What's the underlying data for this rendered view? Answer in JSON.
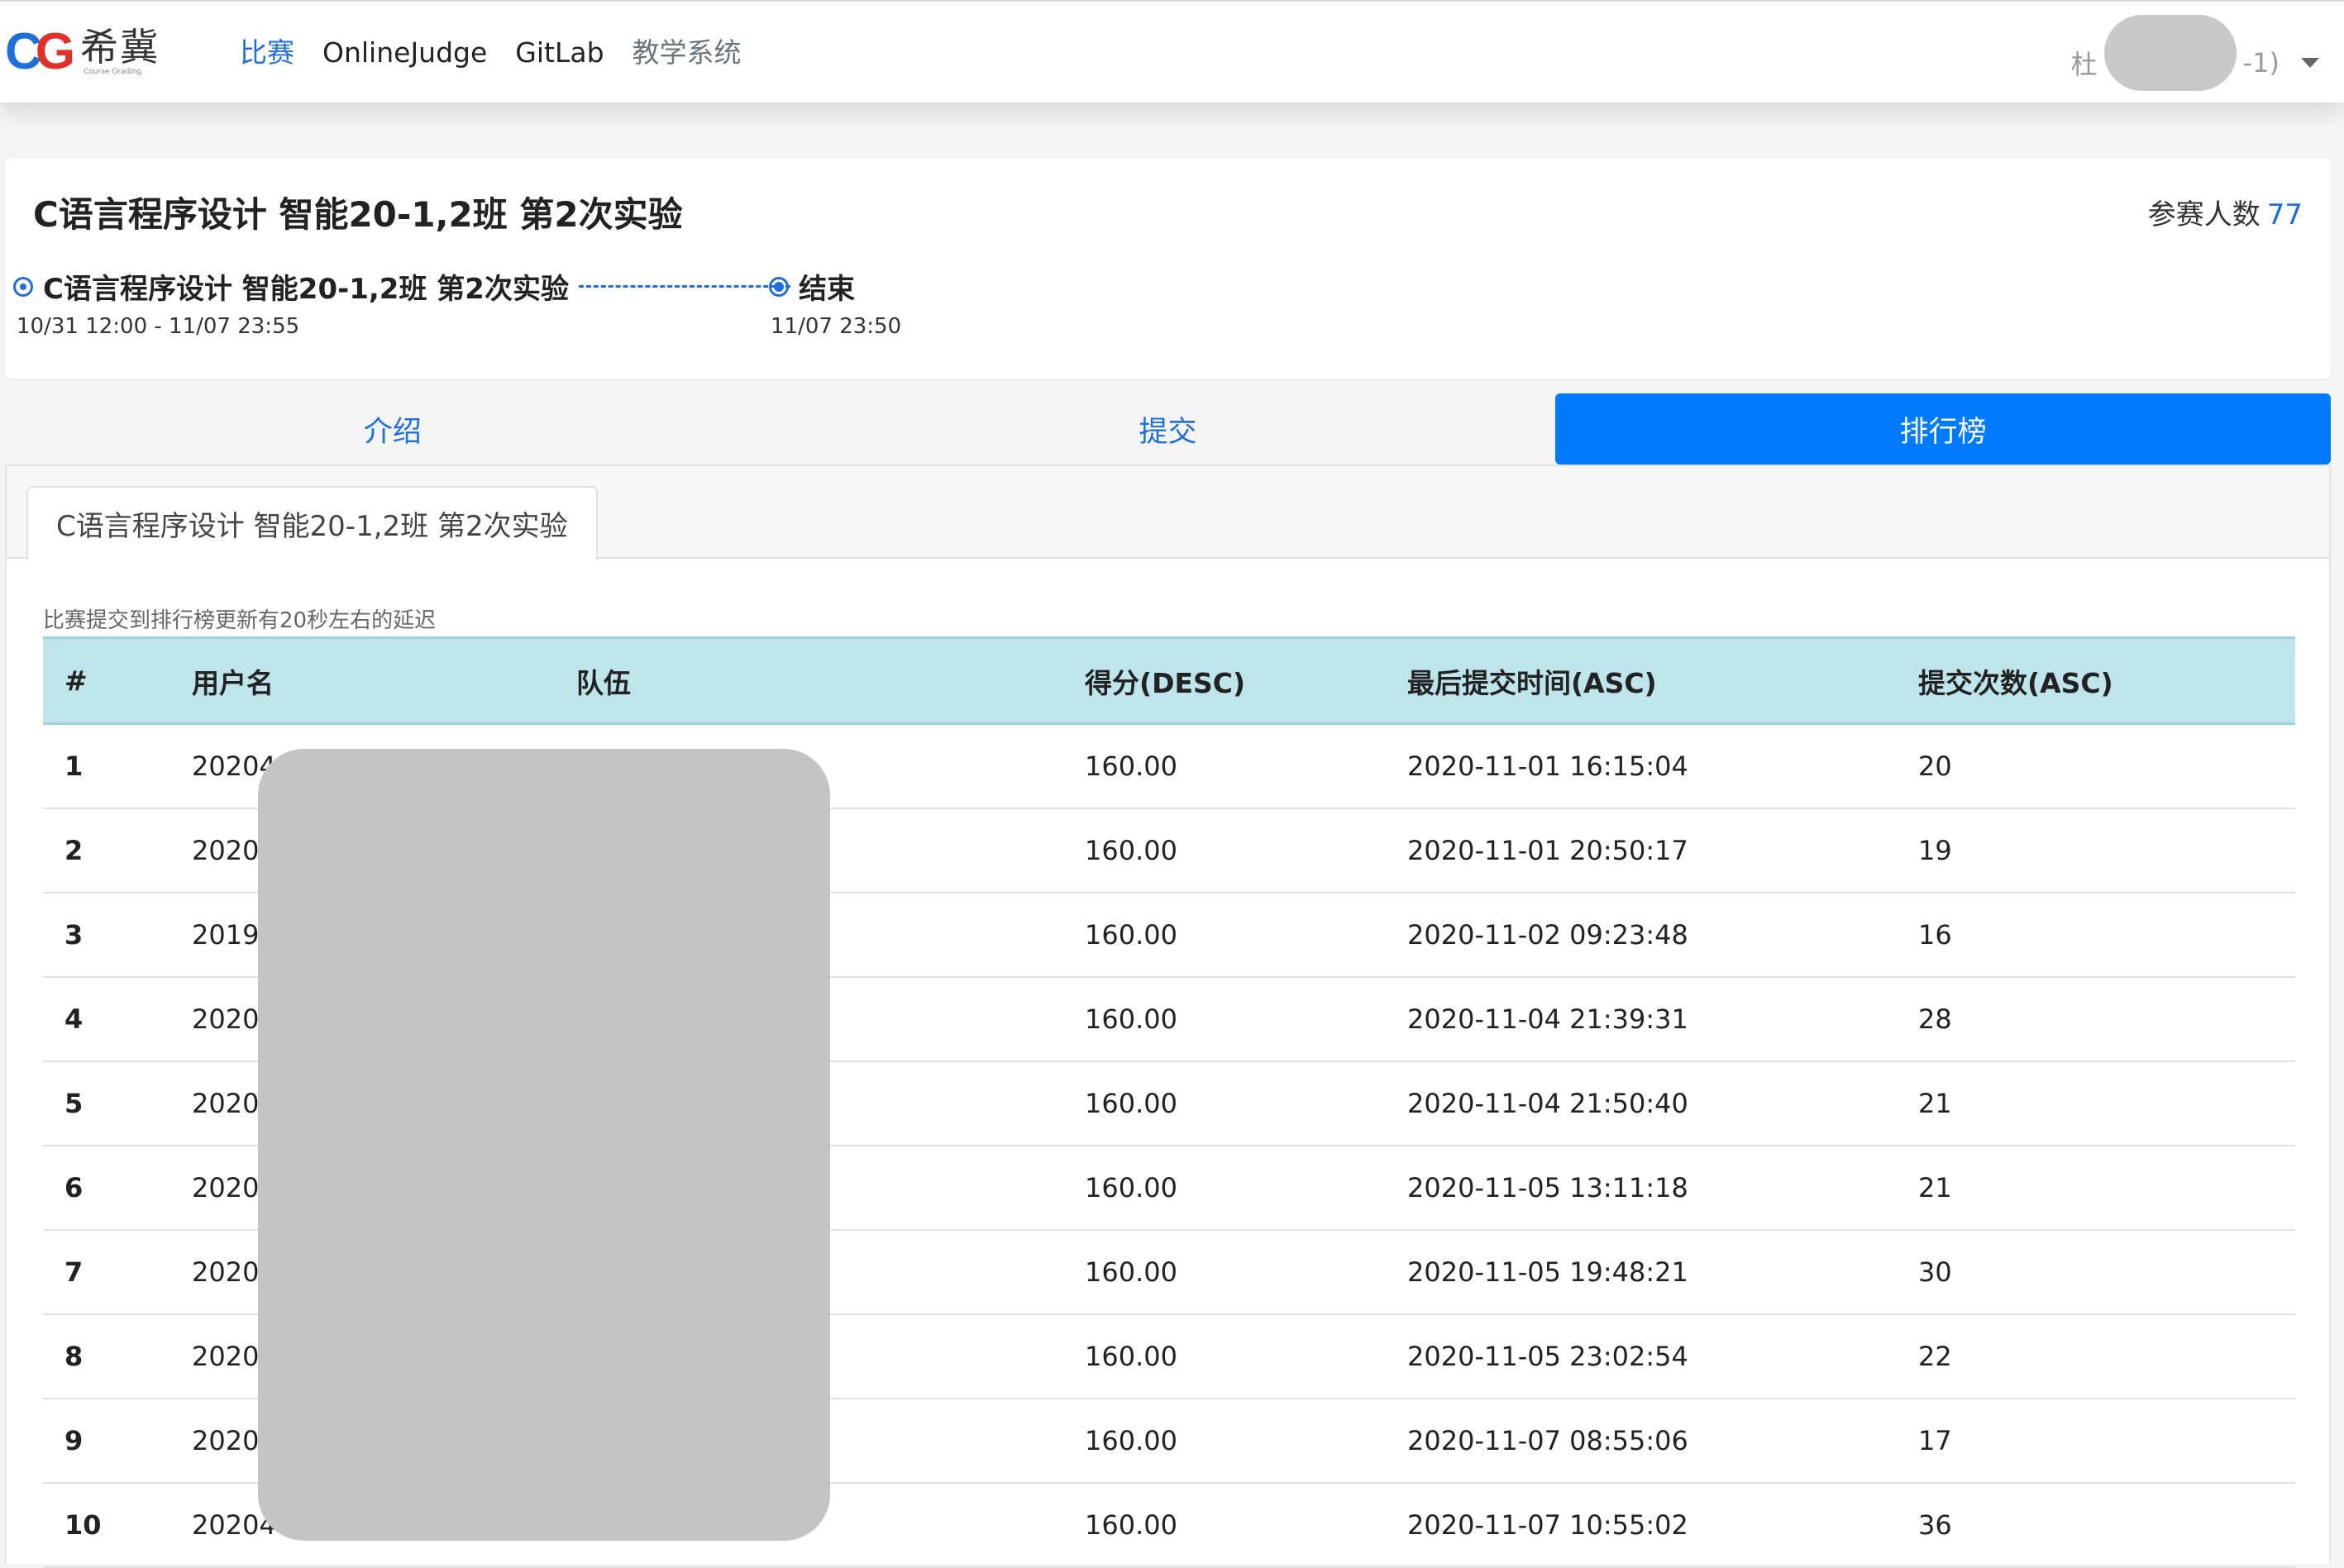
{
  "nav": {
    "logo_mark_c": "C",
    "logo_mark_g": "G",
    "logo_cn": "希冀",
    "logo_en": "Course Grading",
    "items": [
      {
        "label": "比赛"
      },
      {
        "label": "OnlineJudge"
      },
      {
        "label": "GitLab"
      },
      {
        "label": "教学系统"
      }
    ],
    "user_prefix": "杜",
    "user_suffix": "-1)"
  },
  "contest": {
    "title": "C语言程序设计 智能20-1,2班 第2次实验",
    "participants_label": "参赛人数",
    "participants_count": "77",
    "timeline": [
      {
        "label": "C语言程序设计 智能20-1,2班 第2次实验",
        "time": "10/31 12:00 - 11/07 23:55"
      },
      {
        "label": "结束",
        "time": "11/07 23:50"
      }
    ]
  },
  "tabs": [
    {
      "label": "介绍"
    },
    {
      "label": "提交"
    },
    {
      "label": "排行榜"
    }
  ],
  "subtab": {
    "label": "C语言程序设计 智能20-1,2班 第2次实验"
  },
  "notice": "比赛提交到排行榜更新有20秒左右的延迟",
  "table": {
    "headers": [
      "#",
      "用户名",
      "队伍",
      "得分(DESC)",
      "最后提交时间(ASC)",
      "提交次数(ASC)"
    ],
    "rows": [
      {
        "rank": "1",
        "user": "202044",
        "team": "",
        "score": "160.00",
        "time": "2020-11-01 16:15:04",
        "count": "20"
      },
      {
        "rank": "2",
        "user": "20204",
        "team": "",
        "score": "160.00",
        "time": "2020-11-01 20:50:17",
        "count": "19"
      },
      {
        "rank": "3",
        "user": "20194",
        "team": "",
        "score": "160.00",
        "time": "2020-11-02 09:23:48",
        "count": "16"
      },
      {
        "rank": "4",
        "user": "20204",
        "team": "",
        "score": "160.00",
        "time": "2020-11-04 21:39:31",
        "count": "28"
      },
      {
        "rank": "5",
        "user": "20204",
        "team": "",
        "score": "160.00",
        "time": "2020-11-04 21:50:40",
        "count": "21"
      },
      {
        "rank": "6",
        "user": "20204",
        "team": "",
        "score": "160.00",
        "time": "2020-11-05 13:11:18",
        "count": "21"
      },
      {
        "rank": "7",
        "user": "20204",
        "team": "",
        "score": "160.00",
        "time": "2020-11-05 19:48:21",
        "count": "30"
      },
      {
        "rank": "8",
        "user": "20204",
        "team": "",
        "score": "160.00",
        "time": "2020-11-05 23:02:54",
        "count": "22"
      },
      {
        "rank": "9",
        "user": "20204",
        "team": "",
        "score": "160.00",
        "time": "2020-11-07 08:55:06",
        "count": "17"
      },
      {
        "rank": "10",
        "user": "202044",
        "team": "",
        "score": "160.00",
        "time": "2020-11-07 10:55:02",
        "count": "36"
      }
    ]
  }
}
